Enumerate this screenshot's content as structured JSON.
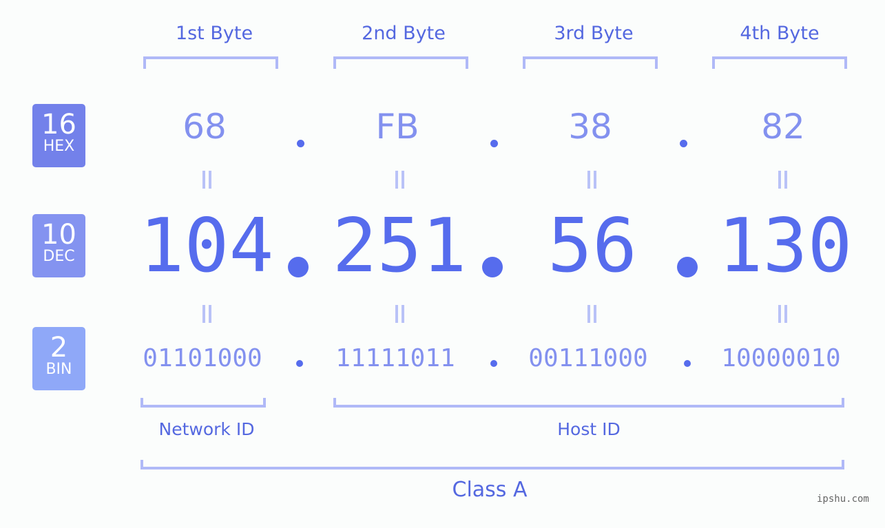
{
  "bytes": {
    "labels": [
      "1st Byte",
      "2nd Byte",
      "3rd Byte",
      "4th Byte"
    ]
  },
  "badges": {
    "hex": {
      "base": "16",
      "name": "HEX",
      "color": "#7381ea"
    },
    "dec": {
      "base": "10",
      "name": "DEC",
      "color": "#8493f0"
    },
    "bin": {
      "base": "2",
      "name": "BIN",
      "color": "#8fa8f8"
    }
  },
  "ip": {
    "hex": [
      "68",
      "FB",
      "38",
      "82"
    ],
    "dec": [
      "104",
      "251",
      "56",
      "130"
    ],
    "bin": [
      "01101000",
      "11111011",
      "00111000",
      "10000010"
    ],
    "separator": "."
  },
  "segments": {
    "network_id": "Network ID",
    "host_id": "Host ID",
    "class": "Class A"
  },
  "watermark": "ipshu.com",
  "colors": {
    "accent": "#566ced",
    "light": "#8391ef",
    "bracket": "#b0b9f7"
  }
}
